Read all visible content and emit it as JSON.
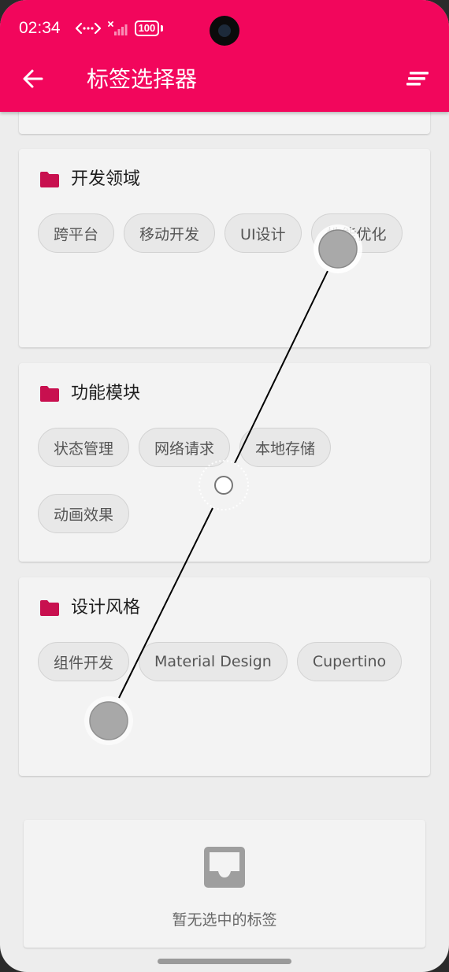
{
  "status_bar": {
    "time": "02:34",
    "battery": "100"
  },
  "app_bar": {
    "title": "标签选择器",
    "back_icon": "arrow-back-icon",
    "sort_icon": "sort-icon"
  },
  "sections": [
    {
      "title": "开发领域",
      "icon": "folder-icon",
      "tags": [
        "跨平台",
        "移动开发",
        "UI设计",
        "性能优化"
      ]
    },
    {
      "title": "功能模块",
      "icon": "folder-icon",
      "tags": [
        "状态管理",
        "网络请求",
        "本地存储",
        "动画效果"
      ]
    },
    {
      "title": "设计风格",
      "icon": "folder-icon",
      "tags": [
        "组件开发",
        "Material Design",
        "Cupertino"
      ]
    }
  ],
  "empty_state": {
    "icon": "inbox-icon",
    "text": "暂无选中的标签"
  },
  "colors": {
    "primary": "#f2065c",
    "folder": "#c8104f",
    "chip_bg": "#e8e8e8",
    "chip_text": "#555555",
    "card_bg": "#f3f3f3",
    "page_bg": "#ededed"
  }
}
